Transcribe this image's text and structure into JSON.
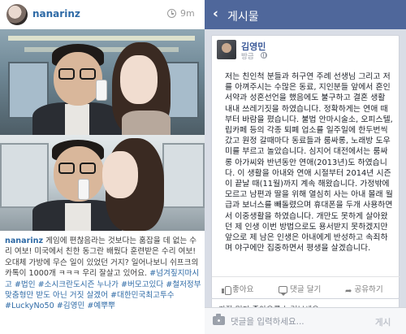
{
  "instagram": {
    "username": "nanarinz",
    "time_ago": "9m",
    "caption": {
      "user": "nanarinz",
      "text": "게임에 편찮음라는 것보다는 훔잡을 데 없는 수리 여보! 미국에서 친한 동그란 배웠다 훈련받은 수리 여보! 오대체 가방에 무슨 일이 있었던 거지? 일어나보니 쉬프크의 카톡이 1000개 ㅋㅋㅋ 우리 잘살고 있어요.",
      "tags": "#넘겨짚지마시고 #법인 #소시크란도시즌 누나가 #버모고있다 #철저정부 맞춤형만 받도 아닌 거짓 살겠어 #대한민국최고투수 #LuckyNo50 #김영민 #예뿌뿌"
    }
  },
  "facebook": {
    "header_title": "게시물",
    "author_name": "김영민",
    "post_time": "방금",
    "post_text": "저는 친인척 분들과 허구연 주례 선생님 그리고 저를 아껴주시는 수많은 동료, 지인분들 앞에서 혼인서약과 성혼선언을 했음에도 불구하고 결혼 생활 내내 쓰레기짓을 하였습니다. 정확하게는 연애 때부터 바람을 폈습니다. 불법 안마시술소, 오피스텔, 립카페 등의 각종 퇴폐 업소를 일주일에 한두번씩 갔고 원정 갈때마다 동료들과 룸싸롱, 노래방 도우미를 부르고 놀았습니다. 심지어 대전에서는 룸싸롱 아가씨와 반년동안 연애(2013년)도 하였습니다. 이 생활을 아내와 연애 시절부터 2014년 시즌이 끝날 때(11월)까지 계속 해왔습니다. 가정밖에 모르고 남편과 딸을 위해 열심히 사는 아내 몰래 월급과 보너스를 빼돌렸으며 휴대폰을 두개 사용하면서 이중생활을 하였습니다. 개만도 못하게 살아왔던 제 인생 이번 방법으로도 용서받지 못하겠지만 앞으로 제 남은 인생은 아내에게 반성하고 속죄하며 야구에만 집중하면서 평생을 살겠습니다.",
    "actions": {
      "like": "좋아요",
      "comment": "댓글 달기",
      "share": "공유하기"
    },
    "first_like_text": "가장 먼저 좋아요를 눌러보세요.",
    "comment_placeholder": "댓글을 입력하세요...",
    "post_button": "게시",
    "colors": {
      "topbar": "#4f679b",
      "name_link": "#3b5998",
      "background": "#d9dde6"
    }
  }
}
